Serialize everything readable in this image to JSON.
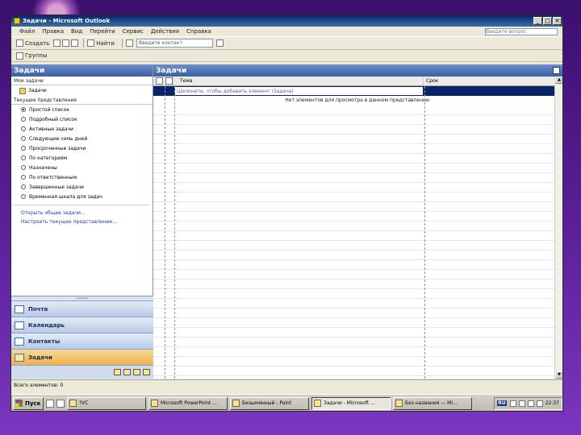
{
  "window": {
    "title": "Задачи - Microsoft Outlook"
  },
  "window_buttons": {
    "minimize": "_",
    "maximize": "□",
    "close": "✕"
  },
  "menu": {
    "items": [
      "Файл",
      "Правка",
      "Вид",
      "Перейти",
      "Сервис",
      "Действия",
      "Справка"
    ],
    "help_placeholder": "Введите вопрос"
  },
  "toolbar": {
    "create_label": "Создать",
    "find_label": "Найти",
    "search_placeholder": "Введите контакт"
  },
  "toolbar2": {
    "group_label": "Группы"
  },
  "nav": {
    "header": "Задачи",
    "my_tasks_title": "Мои задачи",
    "my_tasks_item": "Задачи",
    "current_view_title": "Текущее представление",
    "views": [
      {
        "label": "Простой список",
        "selected": true
      },
      {
        "label": "Подробный список",
        "selected": false
      },
      {
        "label": "Активные задачи",
        "selected": false
      },
      {
        "label": "Следующие семь дней",
        "selected": false
      },
      {
        "label": "Просроченные задачи",
        "selected": false
      },
      {
        "label": "По категориям",
        "selected": false
      },
      {
        "label": "Назначены",
        "selected": false
      },
      {
        "label": "По ответственным",
        "selected": false
      },
      {
        "label": "Завершенные задачи",
        "selected": false
      },
      {
        "label": "Временная шкала для задач",
        "selected": false
      }
    ],
    "links": [
      "Открыть общие задачи...",
      "Настроить текущее представление..."
    ],
    "buttons": [
      {
        "label": "Почта",
        "icon": "mail-icon",
        "active": false
      },
      {
        "label": "Календарь",
        "icon": "calendar-icon",
        "active": false
      },
      {
        "label": "Контакты",
        "icon": "contacts-icon",
        "active": false
      },
      {
        "label": "Задачи",
        "icon": "tasks-icon",
        "active": true
      }
    ]
  },
  "content": {
    "header": "Задачи",
    "columns": {
      "subject": "Тема",
      "due": "Срок"
    },
    "new_item_placeholder": "Щелкните, чтобы добавить элемент (Задача)",
    "empty_message": "Нет элементов для просмотра в данном представлении."
  },
  "status": {
    "text": "Всего элементов: 0"
  },
  "taskbar": {
    "start_label": "Пуск",
    "tasks": [
      {
        "label": "?VC",
        "active": false
      },
      {
        "label": "Microsoft PowerPoint ...",
        "active": false
      },
      {
        "label": "Безымянный - Paint",
        "active": false
      },
      {
        "label": "Задачи - Microsoft ...",
        "active": true
      },
      {
        "label": "Без названия — Mi...",
        "active": false
      }
    ],
    "lang": "RU",
    "clock": "22:37"
  }
}
